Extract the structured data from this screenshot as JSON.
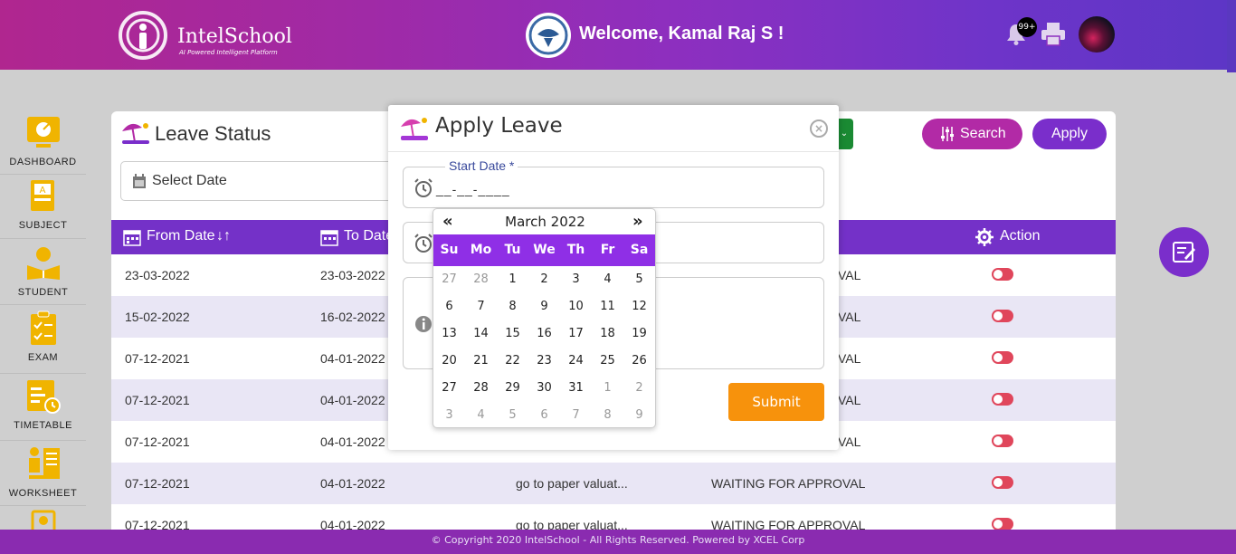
{
  "header": {
    "logo_title": "IntelSchool",
    "logo_subtitle": "AI Powered Intelligent Platform",
    "welcome": "Welcome, Kamal Raj S !",
    "notification_count": "99+"
  },
  "sidebar": {
    "items": [
      {
        "label": "DASHBOARD",
        "icon": "dashboard-icon"
      },
      {
        "label": "SUBJECT",
        "icon": "subject-icon"
      },
      {
        "label": "STUDENT",
        "icon": "student-icon"
      },
      {
        "label": "EXAM",
        "icon": "exam-icon"
      },
      {
        "label": "TIMETABLE",
        "icon": "timetable-icon"
      },
      {
        "label": "WORKSHEET",
        "icon": "worksheet-icon"
      }
    ]
  },
  "card": {
    "title": "Leave Status",
    "select_date": "Select Date",
    "search_label": "Search",
    "apply_label": "Apply",
    "columns": {
      "from_date": "From Date",
      "to_date": "To Date",
      "action": "Action"
    },
    "rows": [
      {
        "from": "23-03-2022",
        "to": "23-03-2022",
        "reason": "",
        "status": "VAL"
      },
      {
        "from": "15-02-2022",
        "to": "16-02-2022",
        "reason": "",
        "status": "VAL"
      },
      {
        "from": "07-12-2021",
        "to": "04-01-2022",
        "reason": "",
        "status": "VAL"
      },
      {
        "from": "07-12-2021",
        "to": "04-01-2022",
        "reason": "",
        "status": "VAL"
      },
      {
        "from": "07-12-2021",
        "to": "04-01-2022",
        "reason": "",
        "status": "VAL"
      },
      {
        "from": "07-12-2021",
        "to": "04-01-2022",
        "reason": "go to paper valuat...",
        "status": "WAITING FOR APPROVAL"
      },
      {
        "from": "07-12-2021",
        "to": "04-01-2022",
        "reason": "go to paper valuat...",
        "status": "WAITING FOR APPROVAL"
      }
    ]
  },
  "modal": {
    "title": "Apply Leave",
    "start_date_label": "Start Date *",
    "start_date_value": "__-__-____",
    "submit_label": "Submit"
  },
  "datepicker": {
    "prev": "«",
    "next": "»",
    "month": "March 2022",
    "dow": [
      "Su",
      "Mo",
      "Tu",
      "We",
      "Th",
      "Fr",
      "Sa"
    ],
    "weeks": [
      [
        [
          "27",
          1
        ],
        [
          "28",
          1
        ],
        [
          "1",
          0
        ],
        [
          "2",
          0
        ],
        [
          "3",
          0
        ],
        [
          "4",
          0
        ],
        [
          "5",
          0
        ]
      ],
      [
        [
          "6",
          0
        ],
        [
          "7",
          0
        ],
        [
          "8",
          0
        ],
        [
          "9",
          0
        ],
        [
          "10",
          0
        ],
        [
          "11",
          0
        ],
        [
          "12",
          0
        ]
      ],
      [
        [
          "13",
          0
        ],
        [
          "14",
          0
        ],
        [
          "15",
          0
        ],
        [
          "16",
          0
        ],
        [
          "17",
          0
        ],
        [
          "18",
          0
        ],
        [
          "19",
          0
        ]
      ],
      [
        [
          "20",
          0
        ],
        [
          "21",
          0
        ],
        [
          "22",
          0
        ],
        [
          "23",
          0
        ],
        [
          "24",
          0
        ],
        [
          "25",
          0
        ],
        [
          "26",
          0
        ]
      ],
      [
        [
          "27",
          0
        ],
        [
          "28",
          0
        ],
        [
          "29",
          0
        ],
        [
          "30",
          0
        ],
        [
          "31",
          0
        ],
        [
          "1",
          1
        ],
        [
          "2",
          1
        ]
      ],
      [
        [
          "3",
          1
        ],
        [
          "4",
          1
        ],
        [
          "5",
          1
        ],
        [
          "6",
          1
        ],
        [
          "7",
          1
        ],
        [
          "8",
          1
        ],
        [
          "9",
          1
        ]
      ]
    ]
  },
  "footer": {
    "text": "© Copyright 2020 IntelSchool - All Rights Reserved. Powered by XCEL Corp"
  },
  "colors": {
    "accent": "#7431c8",
    "submit": "#f7920c",
    "sidebar_icon": "#f0b400"
  }
}
